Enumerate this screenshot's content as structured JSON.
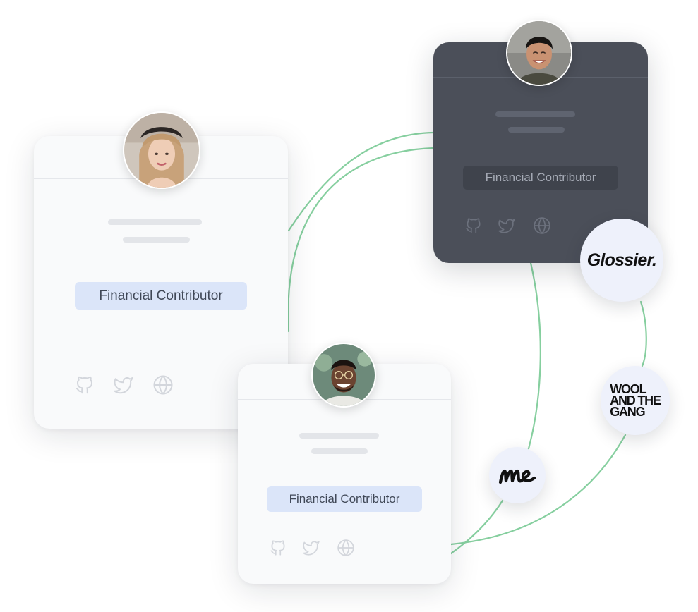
{
  "cards": {
    "left": {
      "badge": "Financial Contributor"
    },
    "dark": {
      "badge": "Financial Contributor"
    },
    "bottom": {
      "badge": "Financial Contributor"
    }
  },
  "icons": [
    "github-icon",
    "twitter-icon",
    "globe-icon"
  ],
  "sponsors": {
    "glossier": "Glossier.",
    "wool": "WOOL\nAND THE\nGANG",
    "me": "me"
  },
  "colors": {
    "connector": "#86cf9f",
    "dark_card": "#4b4f59",
    "light_card": "#f9fafb",
    "badge": "#dbe5f9",
    "sponsor_bg": "#eef1fb"
  }
}
